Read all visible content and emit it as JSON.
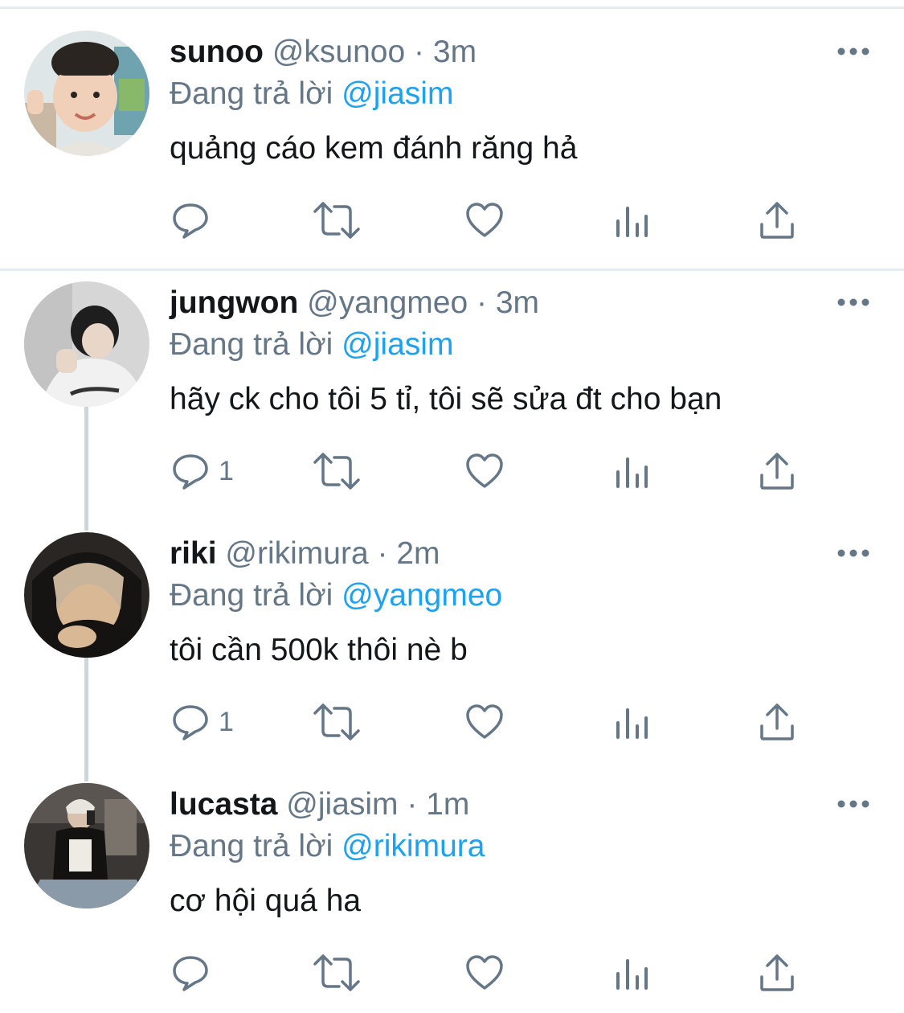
{
  "replying_label": "Đang trả lời",
  "colors": {
    "accent": "#1da1f2",
    "secondary_text": "#657786",
    "primary_text": "#14171a",
    "divider": "#e6ecf0",
    "thread_line": "#ccd6dd"
  },
  "icons": {
    "more": "more-dots-icon",
    "reply": "reply-bubble-icon",
    "retweet": "retweet-arrows-icon",
    "like": "heart-icon",
    "stats": "bar-stats-icon",
    "share": "share-upload-icon"
  },
  "tweets": [
    {
      "name": "sunoo",
      "handle": "@ksunoo",
      "separator": "·",
      "time": "3m",
      "reply_to": "@jiasim",
      "text": "quảng cáo kem đánh răng hả",
      "reply_count": ""
    },
    {
      "name": "jungwon",
      "handle": "@yangmeo",
      "separator": "·",
      "time": "3m",
      "reply_to": "@jiasim",
      "text": "hãy ck cho tôi 5 tỉ, tôi sẽ sửa đt cho bạn",
      "reply_count": "1"
    },
    {
      "name": "riki",
      "handle": "@rikimura",
      "separator": "·",
      "time": "2m",
      "reply_to": "@yangmeo",
      "text": "tôi cần 500k thôi nè b",
      "reply_count": "1"
    },
    {
      "name": "lucasta",
      "handle": "@jiasim",
      "separator": "·",
      "time": "1m",
      "reply_to": "@rikimura",
      "text": "cơ hội quá ha",
      "reply_count": ""
    }
  ]
}
